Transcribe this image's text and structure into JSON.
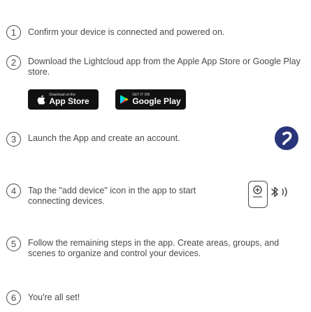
{
  "steps": [
    {
      "num": "1",
      "text": "Confirm your device is connected and powered on."
    },
    {
      "num": "2",
      "text": "Download the Lightcloud app from the Apple App Store or Google Play store."
    },
    {
      "num": "3",
      "text": "Launch the App and create an account."
    },
    {
      "num": "4",
      "text": "Tap the \"add device\" icon in the app to start connecting devices."
    },
    {
      "num": "5",
      "text": "Follow the remaining steps in the app. Create areas, groups, and scenes to organize and control your devices."
    },
    {
      "num": "6",
      "text": "You're all set!"
    }
  ],
  "stores": {
    "apple": {
      "small": "Download on the",
      "big": "App Store"
    },
    "google": {
      "small": "GET IT ON",
      "big": "Google Play"
    }
  },
  "colors": {
    "text": "#4a4a4a",
    "logo": "#28357a"
  },
  "icons": [
    "apple-icon",
    "google-play-icon",
    "lightcloud-logo-icon",
    "add-device-icon",
    "bluetooth-icon",
    "signal-waves-icon"
  ]
}
